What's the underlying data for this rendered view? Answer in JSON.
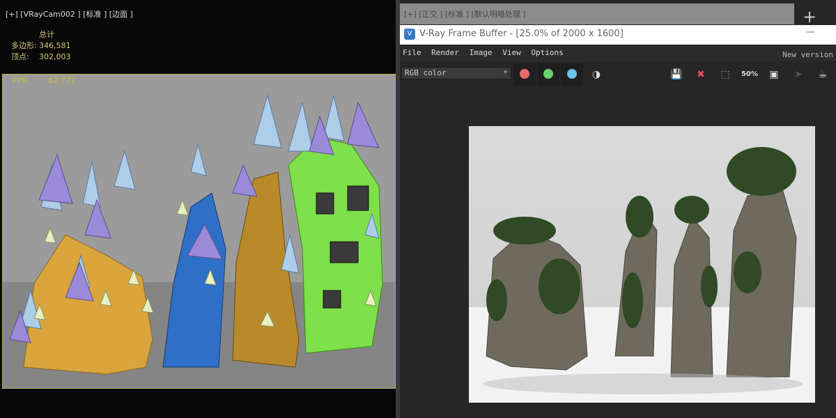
{
  "left_viewport": {
    "label": "[+] [VRayCam002 ] [标准 ] [边面 ]",
    "stats": {
      "header": "总计",
      "polygons_label": "多边形:",
      "polygons": "346,581",
      "vertices_label": "顶点:",
      "vertices": "302,003"
    },
    "fps_label": "FPS:",
    "fps": "62.772"
  },
  "top_viewport": {
    "label": "[+] [正交 ] [标准 ] [默认明暗处理 ]"
  },
  "vfb": {
    "title": "V-Ray Frame Buffer - [25.0% of 2000 x 1600]",
    "menu": [
      "File",
      "Render",
      "Image",
      "View",
      "Options"
    ],
    "new_version": "New version",
    "channel": "RGB color",
    "channel_colors": [
      "#e86b6b",
      "#6bd16b",
      "#6bc3e8"
    ],
    "zoom_label": "50%",
    "icons": [
      "save-icon",
      "clear-icon",
      "region-select-icon",
      "zoom-icon",
      "frame-icon",
      "cursor-icon",
      "render-teapot-icon"
    ]
  }
}
